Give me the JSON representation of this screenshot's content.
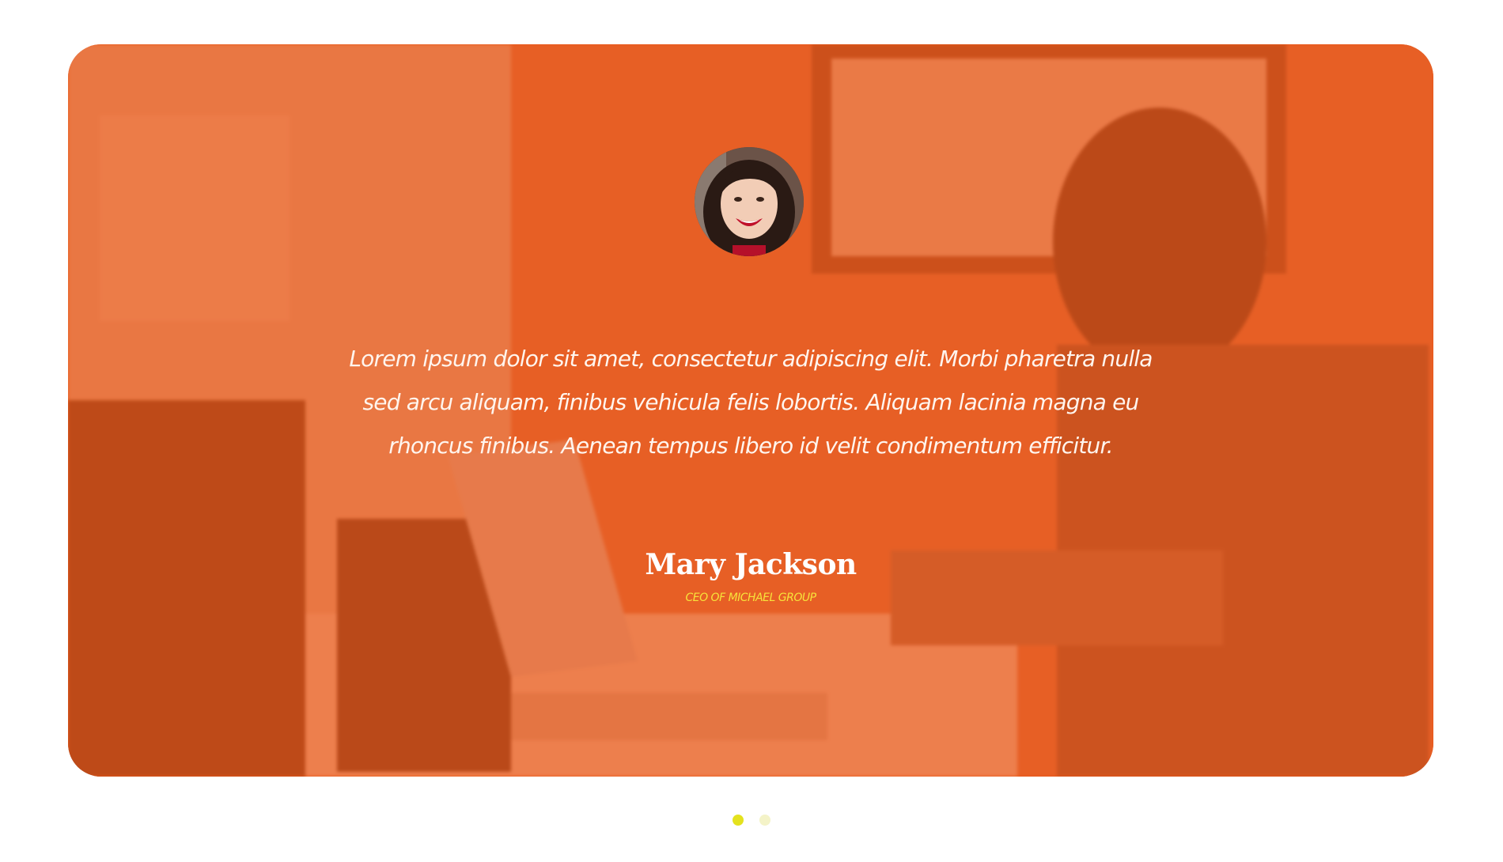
{
  "testimonial": {
    "quote": "Lorem ipsum dolor sit amet, consectetur adipiscing elit. Morbi pharetra nulla sed arcu aliquam, finibus vehicula felis lobortis. Aliquam lacinia magna eu rhoncus finibus. Aenean tempus libero id velit condimentum efficitur.",
    "name": "Mary Jackson",
    "role": "CEO OF MICHAEL GROUP",
    "avatar_icon": "person-avatar-icon"
  },
  "pagination": {
    "total": 2,
    "active": 1
  },
  "colors": {
    "card_overlay": "#ec5818",
    "name_text": "#ffffff",
    "role_text": "#f7e23a",
    "dot_active": "#e4e21e",
    "dot_inactive": "#f4f3c8"
  }
}
